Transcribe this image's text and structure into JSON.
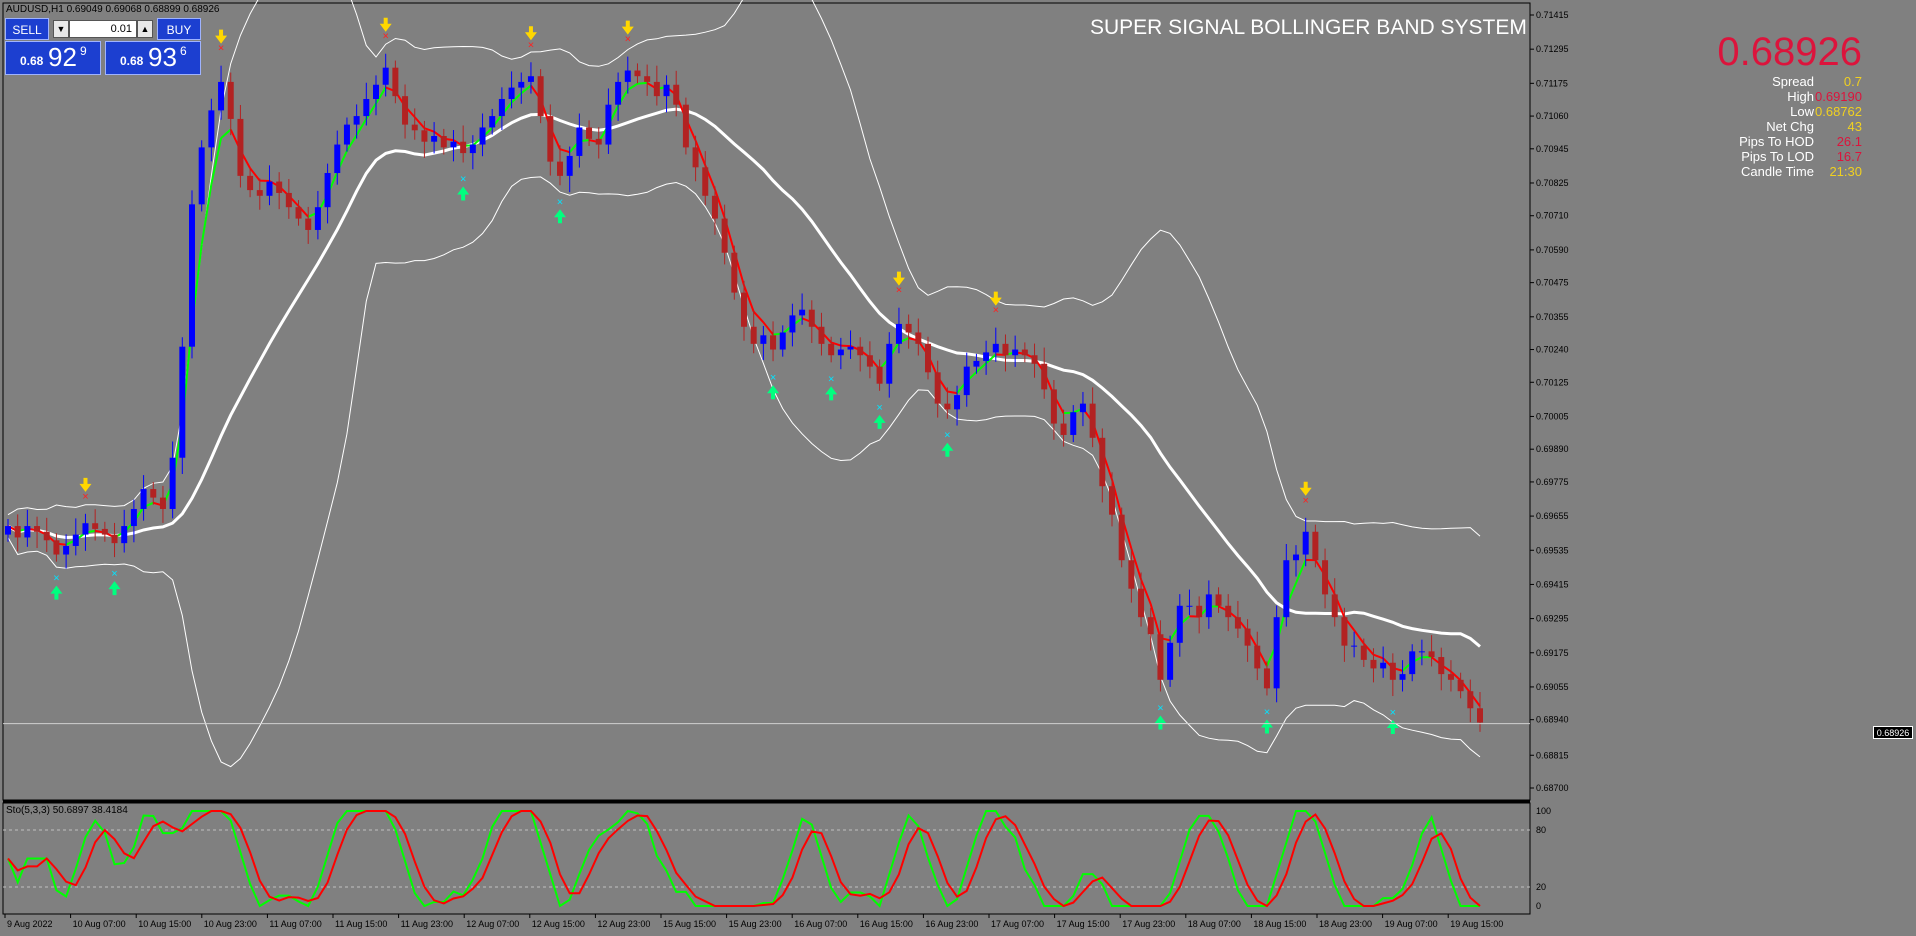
{
  "symbol": {
    "label": "AUDUSD,H1  0.69049 0.69068 0.68899 0.68926"
  },
  "trade_panel": {
    "sell_label": "SELL",
    "buy_label": "BUY",
    "lot_down": "▼",
    "lot_up": "▲",
    "lot_value": "0.01",
    "bid": {
      "small": "0.68",
      "big": "92",
      "sup": "9"
    },
    "ask": {
      "small": "0.68",
      "big": "93",
      "sup": "6"
    }
  },
  "title": "SUPER SIGNAL BOLLINGER BAND SYSTEM",
  "info_panel": {
    "price": "0.68926",
    "rows": [
      {
        "label": "Spread",
        "value": "0.7",
        "color": "#f0d020"
      },
      {
        "label": "High",
        "value": "0.69190",
        "color": "#dc143c"
      },
      {
        "label": "Low",
        "value": "0.68762",
        "color": "#f0d020"
      },
      {
        "label": "Net Chg",
        "value": "43",
        "color": "#f0d020"
      },
      {
        "label": "Pips To HOD",
        "value": "26.1",
        "color": "#dc143c"
      },
      {
        "label": "Pips To LOD",
        "value": "16.7",
        "color": "#dc143c"
      },
      {
        "label": "Candle Time",
        "value": "21:30",
        "color": "#f0d020"
      }
    ]
  },
  "price_axis": {
    "labels": [
      "0.71415",
      "0.71295",
      "0.71175",
      "0.71060",
      "0.70945",
      "0.70825",
      "0.70710",
      "0.70590",
      "0.70475",
      "0.70355",
      "0.70240",
      "0.70125",
      "0.70005",
      "0.69890",
      "0.69775",
      "0.69655",
      "0.69535",
      "0.69415",
      "0.69295",
      "0.69175",
      "0.69055",
      "0.68940",
      "0.68815",
      "0.68700"
    ],
    "current_price_tag": "0.68926"
  },
  "stochastic": {
    "label": "Sto(5,3,3) 50.6897 38.4184",
    "levels": [
      "100",
      "80",
      "20",
      "0"
    ]
  },
  "time_axis": {
    "labels": [
      "9 Aug 2022",
      "10 Aug 07:00",
      "10 Aug 15:00",
      "10 Aug 23:00",
      "11 Aug 07:00",
      "11 Aug 15:00",
      "11 Aug 23:00",
      "12 Aug 07:00",
      "12 Aug 15:00",
      "12 Aug 23:00",
      "15 Aug 15:00",
      "15 Aug 23:00",
      "16 Aug 07:00",
      "16 Aug 15:00",
      "16 Aug 23:00",
      "17 Aug 07:00",
      "17 Aug 15:00",
      "17 Aug 23:00",
      "18 Aug 07:00",
      "18 Aug 15:00",
      "18 Aug 23:00",
      "19 Aug 07:00",
      "19 Aug 15:00"
    ]
  },
  "colors": {
    "background": "#808080",
    "bull_candle": "#0000ff",
    "bear_candle": "#b22222",
    "band": "#ffffff",
    "mid_band": "#ffffff",
    "fast_line_up": "#00ff00",
    "fast_line_down": "#ff0000",
    "buy_arrow": "#00ff7f",
    "sell_arrow": "#ffd700",
    "buy_cross": "#00e5ff",
    "sell_cross": "#ff2020",
    "sto_main": "#00ff00",
    "sto_signal": "#ff0000"
  },
  "chart_data": {
    "type": "candlestick",
    "symbol": "AUDUSD",
    "timeframe": "H1",
    "ylim": [
      0.687,
      0.71415
    ],
    "close": [
      0.6962,
      0.6958,
      0.6962,
      0.696,
      0.6957,
      0.6952,
      0.6955,
      0.6959,
      0.6963,
      0.6961,
      0.6959,
      0.6956,
      0.6962,
      0.6968,
      0.6975,
      0.6972,
      0.6968,
      0.6986,
      0.7025,
      0.7075,
      0.7095,
      0.7108,
      0.7118,
      0.7105,
      0.7085,
      0.708,
      0.7078,
      0.7083,
      0.7079,
      0.7074,
      0.707,
      0.7066,
      0.7074,
      0.7086,
      0.7096,
      0.7103,
      0.7106,
      0.7112,
      0.7117,
      0.7123,
      0.7113,
      0.7103,
      0.7101,
      0.7097,
      0.7099,
      0.7095,
      0.7097,
      0.7093,
      0.7096,
      0.7102,
      0.7106,
      0.7112,
      0.7116,
      0.7118,
      0.712,
      0.7106,
      0.709,
      0.7085,
      0.7092,
      0.7102,
      0.7098,
      0.7096,
      0.711,
      0.7118,
      0.7122,
      0.712,
      0.7118,
      0.7113,
      0.7117,
      0.711,
      0.7095,
      0.7088,
      0.7078,
      0.707,
      0.7058,
      0.7044,
      0.7032,
      0.7026,
      0.7029,
      0.7024,
      0.703,
      0.7036,
      0.7038,
      0.7032,
      0.7026,
      0.7022,
      0.7024,
      0.7025,
      0.7022,
      0.7018,
      0.7012,
      0.7026,
      0.7033,
      0.703,
      0.7026,
      0.7016,
      0.7005,
      0.7003,
      0.7008,
      0.7018,
      0.702,
      0.7023,
      0.7026,
      0.7022,
      0.7024,
      0.7022,
      0.7019,
      0.701,
      0.6998,
      0.6994,
      0.7002,
      0.7005,
      0.6993,
      0.6976,
      0.6966,
      0.695,
      0.694,
      0.693,
      0.6924,
      0.6908,
      0.6921,
      0.6934,
      0.6934,
      0.693,
      0.6938,
      0.6934,
      0.693,
      0.6926,
      0.692,
      0.6912,
      0.6905,
      0.693,
      0.695,
      0.6952,
      0.696,
      0.695,
      0.6938,
      0.693,
      0.692,
      0.692,
      0.6915,
      0.6912,
      0.6914,
      0.6908,
      0.691,
      0.6918,
      0.6918,
      0.6916,
      0.691,
      0.6908,
      0.6904,
      0.6898,
      0.6893
    ],
    "open_offset_note": "",
    "bollinger": {
      "period": 20
    },
    "stochastic": {
      "k": 5,
      "d": 3,
      "slowing": 3,
      "main": 50.6897,
      "signal": 38.4184
    }
  }
}
